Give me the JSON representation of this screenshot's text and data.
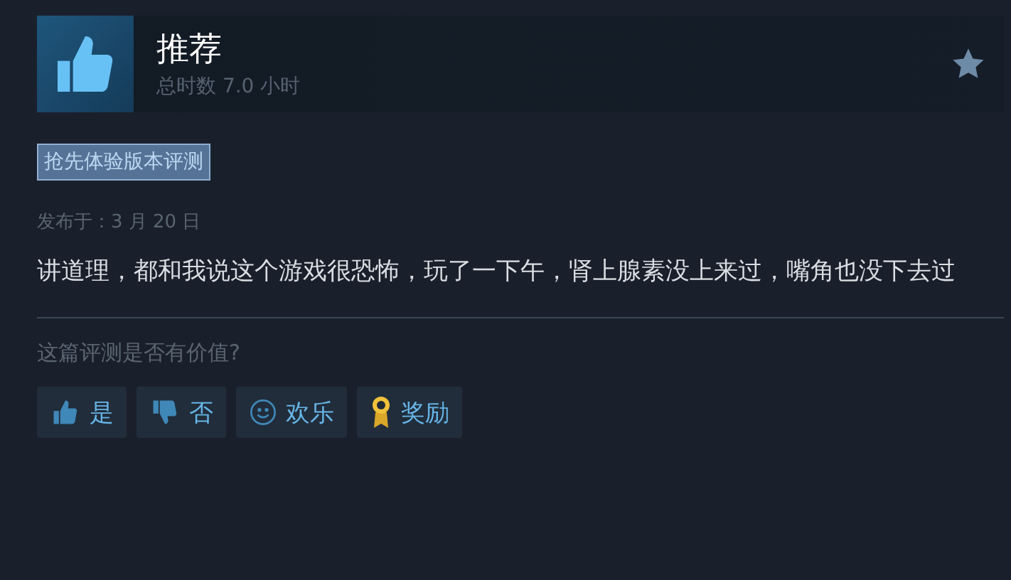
{
  "review": {
    "recommended": true,
    "verdict": "推荐",
    "hours": "总时数 7.0 小时",
    "tag": "抢先体验版本评测",
    "posted": "发布于：3 月 20 日",
    "body": "讲道理，都和我说这个游戏很恐怖，玩了一下午，肾上腺素没上来过，嘴角也没下去过"
  },
  "helpful": {
    "question": "这篇评测是否有价值?",
    "buttons": [
      {
        "kind": "yes",
        "label": "是"
      },
      {
        "kind": "no",
        "label": "否"
      },
      {
        "kind": "funny",
        "label": "欢乐"
      },
      {
        "kind": "award",
        "label": "奖励"
      }
    ]
  }
}
